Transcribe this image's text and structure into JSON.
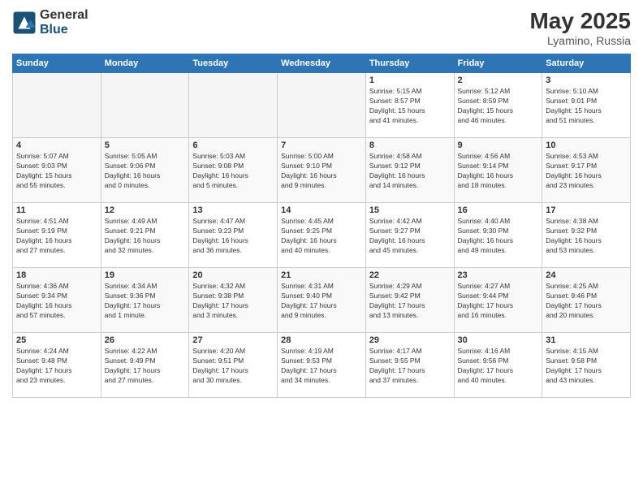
{
  "header": {
    "logo_general": "General",
    "logo_blue": "Blue",
    "month": "May 2025",
    "location": "Lyamino, Russia"
  },
  "days_of_week": [
    "Sunday",
    "Monday",
    "Tuesday",
    "Wednesday",
    "Thursday",
    "Friday",
    "Saturday"
  ],
  "weeks": [
    [
      {
        "day": "",
        "info": "",
        "empty": true
      },
      {
        "day": "",
        "info": "",
        "empty": true
      },
      {
        "day": "",
        "info": "",
        "empty": true
      },
      {
        "day": "",
        "info": "",
        "empty": true
      },
      {
        "day": "1",
        "info": "Sunrise: 5:15 AM\nSunset: 8:57 PM\nDaylight: 15 hours\nand 41 minutes.",
        "empty": false
      },
      {
        "day": "2",
        "info": "Sunrise: 5:12 AM\nSunset: 8:59 PM\nDaylight: 15 hours\nand 46 minutes.",
        "empty": false
      },
      {
        "day": "3",
        "info": "Sunrise: 5:10 AM\nSunset: 9:01 PM\nDaylight: 15 hours\nand 51 minutes.",
        "empty": false
      }
    ],
    [
      {
        "day": "4",
        "info": "Sunrise: 5:07 AM\nSunset: 9:03 PM\nDaylight: 15 hours\nand 55 minutes.",
        "empty": false
      },
      {
        "day": "5",
        "info": "Sunrise: 5:05 AM\nSunset: 9:06 PM\nDaylight: 16 hours\nand 0 minutes.",
        "empty": false
      },
      {
        "day": "6",
        "info": "Sunrise: 5:03 AM\nSunset: 9:08 PM\nDaylight: 16 hours\nand 5 minutes.",
        "empty": false
      },
      {
        "day": "7",
        "info": "Sunrise: 5:00 AM\nSunset: 9:10 PM\nDaylight: 16 hours\nand 9 minutes.",
        "empty": false
      },
      {
        "day": "8",
        "info": "Sunrise: 4:58 AM\nSunset: 9:12 PM\nDaylight: 16 hours\nand 14 minutes.",
        "empty": false
      },
      {
        "day": "9",
        "info": "Sunrise: 4:56 AM\nSunset: 9:14 PM\nDaylight: 16 hours\nand 18 minutes.",
        "empty": false
      },
      {
        "day": "10",
        "info": "Sunrise: 4:53 AM\nSunset: 9:17 PM\nDaylight: 16 hours\nand 23 minutes.",
        "empty": false
      }
    ],
    [
      {
        "day": "11",
        "info": "Sunrise: 4:51 AM\nSunset: 9:19 PM\nDaylight: 16 hours\nand 27 minutes.",
        "empty": false
      },
      {
        "day": "12",
        "info": "Sunrise: 4:49 AM\nSunset: 9:21 PM\nDaylight: 16 hours\nand 32 minutes.",
        "empty": false
      },
      {
        "day": "13",
        "info": "Sunrise: 4:47 AM\nSunset: 9:23 PM\nDaylight: 16 hours\nand 36 minutes.",
        "empty": false
      },
      {
        "day": "14",
        "info": "Sunrise: 4:45 AM\nSunset: 9:25 PM\nDaylight: 16 hours\nand 40 minutes.",
        "empty": false
      },
      {
        "day": "15",
        "info": "Sunrise: 4:42 AM\nSunset: 9:27 PM\nDaylight: 16 hours\nand 45 minutes.",
        "empty": false
      },
      {
        "day": "16",
        "info": "Sunrise: 4:40 AM\nSunset: 9:30 PM\nDaylight: 16 hours\nand 49 minutes.",
        "empty": false
      },
      {
        "day": "17",
        "info": "Sunrise: 4:38 AM\nSunset: 9:32 PM\nDaylight: 16 hours\nand 53 minutes.",
        "empty": false
      }
    ],
    [
      {
        "day": "18",
        "info": "Sunrise: 4:36 AM\nSunset: 9:34 PM\nDaylight: 16 hours\nand 57 minutes.",
        "empty": false
      },
      {
        "day": "19",
        "info": "Sunrise: 4:34 AM\nSunset: 9:36 PM\nDaylight: 17 hours\nand 1 minute.",
        "empty": false
      },
      {
        "day": "20",
        "info": "Sunrise: 4:32 AM\nSunset: 9:38 PM\nDaylight: 17 hours\nand 3 minutes.",
        "empty": false
      },
      {
        "day": "21",
        "info": "Sunrise: 4:31 AM\nSunset: 9:40 PM\nDaylight: 17 hours\nand 9 minutes.",
        "empty": false
      },
      {
        "day": "22",
        "info": "Sunrise: 4:29 AM\nSunset: 9:42 PM\nDaylight: 17 hours\nand 13 minutes.",
        "empty": false
      },
      {
        "day": "23",
        "info": "Sunrise: 4:27 AM\nSunset: 9:44 PM\nDaylight: 17 hours\nand 16 minutes.",
        "empty": false
      },
      {
        "day": "24",
        "info": "Sunrise: 4:25 AM\nSunset: 9:46 PM\nDaylight: 17 hours\nand 20 minutes.",
        "empty": false
      }
    ],
    [
      {
        "day": "25",
        "info": "Sunrise: 4:24 AM\nSunset: 9:48 PM\nDaylight: 17 hours\nand 23 minutes.",
        "empty": false
      },
      {
        "day": "26",
        "info": "Sunrise: 4:22 AM\nSunset: 9:49 PM\nDaylight: 17 hours\nand 27 minutes.",
        "empty": false
      },
      {
        "day": "27",
        "info": "Sunrise: 4:20 AM\nSunset: 9:51 PM\nDaylight: 17 hours\nand 30 minutes.",
        "empty": false
      },
      {
        "day": "28",
        "info": "Sunrise: 4:19 AM\nSunset: 9:53 PM\nDaylight: 17 hours\nand 34 minutes.",
        "empty": false
      },
      {
        "day": "29",
        "info": "Sunrise: 4:17 AM\nSunset: 9:55 PM\nDaylight: 17 hours\nand 37 minutes.",
        "empty": false
      },
      {
        "day": "30",
        "info": "Sunrise: 4:16 AM\nSunset: 9:56 PM\nDaylight: 17 hours\nand 40 minutes.",
        "empty": false
      },
      {
        "day": "31",
        "info": "Sunrise: 4:15 AM\nSunset: 9:58 PM\nDaylight: 17 hours\nand 43 minutes.",
        "empty": false
      }
    ]
  ]
}
